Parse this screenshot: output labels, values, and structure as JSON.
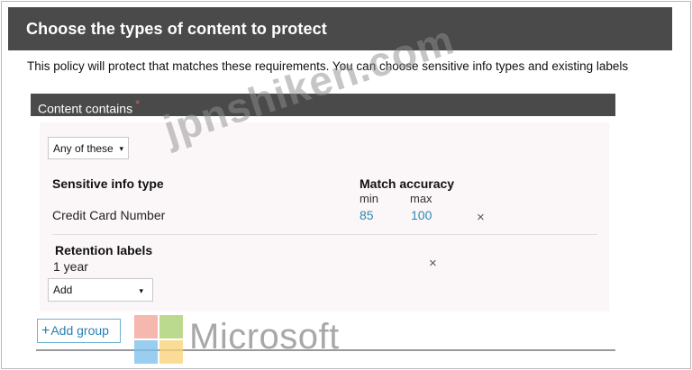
{
  "header": {
    "title": "Choose the types of content to protect"
  },
  "description": "This policy will protect that matches these requirements. You can choose sensitive info types and existing labels",
  "content_section": {
    "title": "Content contains",
    "required_marker": "*",
    "condition_dropdown": {
      "selected": "Any of these",
      "caret": "▾"
    },
    "sensitive_info": {
      "column_header": "Sensitive info type",
      "accuracy_header": "Match accuracy",
      "min_label": "min",
      "max_label": "max",
      "rows": [
        {
          "name": "Credit Card Number",
          "min": "85",
          "max": "100",
          "remove": "×"
        }
      ]
    },
    "retention": {
      "header": "Retention labels",
      "value": "1 year",
      "remove": "×",
      "add_dropdown": {
        "selected": "Add",
        "caret": "▾"
      }
    }
  },
  "add_group": {
    "plus": "+",
    "label": "Add group"
  },
  "logo": {
    "text": "Microsoft"
  },
  "watermark": "jpnshiken.com"
}
